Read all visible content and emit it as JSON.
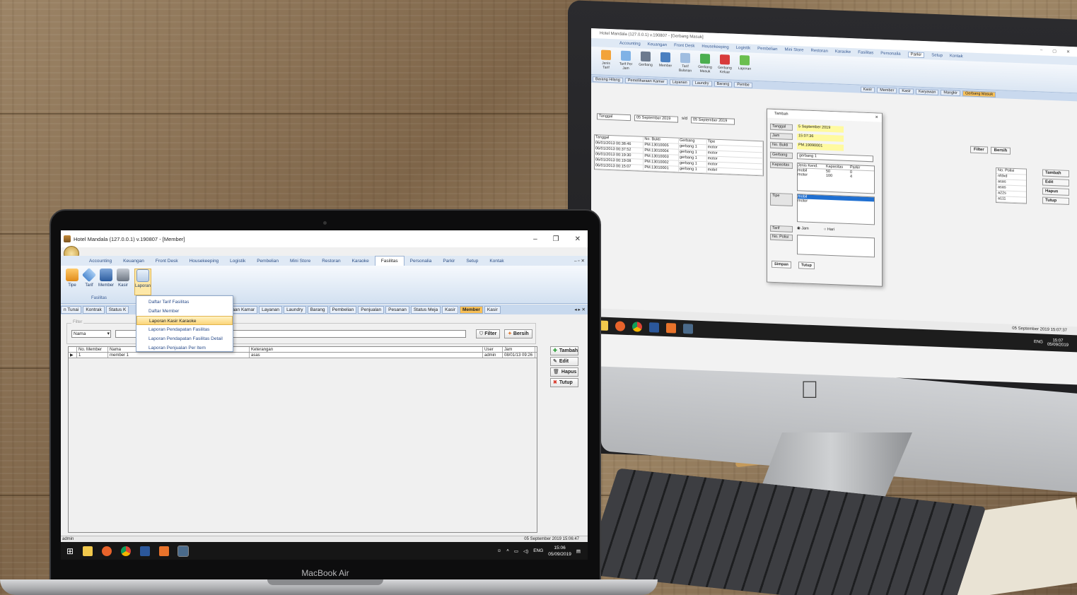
{
  "macbook": {
    "brand": "MacBook Air",
    "window_title": "Hotel Mandala  (127.0.0.1) v.190807 - [Member]",
    "menu": [
      "Accounting",
      "Keuangan",
      "Front Desk",
      "Housekeeping",
      "Logistik",
      "Pembelian",
      "Mini Store",
      "Restoran",
      "Karaoke",
      "Fasilitas",
      "Personalia",
      "Parkir",
      "Setup",
      "Kontak"
    ],
    "active_menu": "Fasilitas",
    "ribbon": {
      "buttons": [
        "Tipe",
        "Tarif",
        "Member",
        "Kasir",
        "Laporan"
      ],
      "group_label": "Fasilitas"
    },
    "dropdown": {
      "items": [
        "Daftar Tarif Fasilitas",
        "Daftar Member",
        "Laporan Kasir Karaoke",
        "Laporan Pendapatan Fasilitas",
        "Laporan Pendapatan Fasilitas Detail",
        "Laporan Penjualan Per Item"
      ],
      "highlighted": "Laporan Kasir Karaoke"
    },
    "tabs": [
      "n Tunai",
      "Kontrak",
      "Status K",
      "aan Kamar",
      "Layanan",
      "Laundry",
      "Barang",
      "Pembelian",
      "Penjualan",
      "Pesanan",
      "Status Meja",
      "Kasir",
      "Member",
      "Kasir"
    ],
    "active_tab": "Member",
    "filter": {
      "legend": "Filter",
      "field": "Nama",
      "filter_button": "Filter",
      "clear_button": "Bersih"
    },
    "grid": {
      "columns": [
        "No. Member",
        "Nama",
        "Keterangan",
        "User",
        "Jam"
      ],
      "rows": [
        {
          "no": "1",
          "nama": "member 1",
          "keterangan": "asas",
          "user": "admin",
          "jam": "08/01/13 09:26"
        }
      ]
    },
    "side_buttons": [
      "Tambah",
      "Edit",
      "Hapus",
      "Tutup"
    ],
    "status": {
      "user": "admin",
      "datetime": "05 September 2019  15:06:47"
    },
    "taskbar": {
      "lang": "ENG",
      "time": "15:06",
      "date": "05/09/2019"
    }
  },
  "imac": {
    "window_title": "Hotel Mandala  (127.0.0.1) v.190807 - [Gerbang Masuk]",
    "menu": [
      "Accounting",
      "Keuangan",
      "Front Desk",
      "Housekeeping",
      "Logistik",
      "Pembelian",
      "Mini Store",
      "Restoran",
      "Karaoke",
      "Fasilitas",
      "Personalia",
      "Parkir",
      "Setup",
      "Kontak"
    ],
    "active_menu": "Parkir",
    "ribbon": [
      "Jenis Tarif",
      "Tarif Per Jam",
      "Gerbang",
      "Member",
      "Tarif Bulanan",
      "Gerbang Masuk",
      "Gerbang Keluar",
      "Laporan"
    ],
    "ribbon_groups": [
      "Parkir",
      "Transaksi",
      "Laporan"
    ],
    "tabs": [
      "Barang Hilang",
      "Pemeliharaan Kamar",
      "Layanan",
      "Laundry",
      "Barang",
      "Pembe",
      "Kasir",
      "Member",
      "Kasir",
      "Karyawan",
      "Mangkir",
      "Gerbang Masuk"
    ],
    "filter": {
      "field": "Tanggal",
      "from": "05 September 2019",
      "sd": "s/d",
      "to": "05 September 2019",
      "filter_button": "Filter",
      "clear_button": "Bersih"
    },
    "grid": {
      "columns": [
        "Tanggal",
        "No. Bukti",
        "Gerbang",
        "Tipe"
      ],
      "rows": [
        [
          "06/01/2013 00:38:46",
          "PM.13010005",
          "gerbang 1",
          "motor"
        ],
        [
          "06/01/2013 00:37:52",
          "PM.13010004",
          "gerbang 1",
          "motor"
        ],
        [
          "06/01/2013 00:19:30",
          "PM.13010003",
          "gerbang 1",
          "motor"
        ],
        [
          "06/01/2013 00:19:08",
          "PM.13010002",
          "gerbang 1",
          "motor"
        ],
        [
          "06/01/2013 00:15:07",
          "PM.13010001",
          "gerbang 1",
          "mobil"
        ]
      ],
      "right_header": "No. Polisi",
      "right_values": [
        "nfdvd",
        "asas",
        "asas",
        "a22s",
        "a111"
      ]
    },
    "side_buttons": [
      "Tambah",
      "Edit",
      "Hapus",
      "Tutup"
    ],
    "dialog": {
      "title": "Tambah",
      "labels": [
        "Tanggal",
        "Jam",
        "No. Bukti",
        "Gerbang",
        "Kapasitas",
        "Tipe",
        "Tarif",
        "No. Polisi"
      ],
      "tanggal": "5 September 2019",
      "jam": "15:07:36",
      "no_bukti": "PM.19090001",
      "gerbang": "gerbang 1",
      "kapasitas_columns": [
        "Jenis Kend.",
        "Kapasitas",
        "Parkir"
      ],
      "kapasitas_rows": [
        [
          "mobil",
          "50",
          "0"
        ],
        [
          "motor",
          "100",
          "4"
        ]
      ],
      "tipe_options": [
        "mobil",
        "motor"
      ],
      "tarif_options": [
        "Jam",
        "Hari"
      ],
      "save_button": "Simpan",
      "close_button": "Tutup"
    },
    "status": {
      "datetime": "05 September 2019  15:07:37"
    },
    "taskbar": {
      "lang": "ENG",
      "time": "15:07",
      "date": "05/09/2019"
    }
  }
}
